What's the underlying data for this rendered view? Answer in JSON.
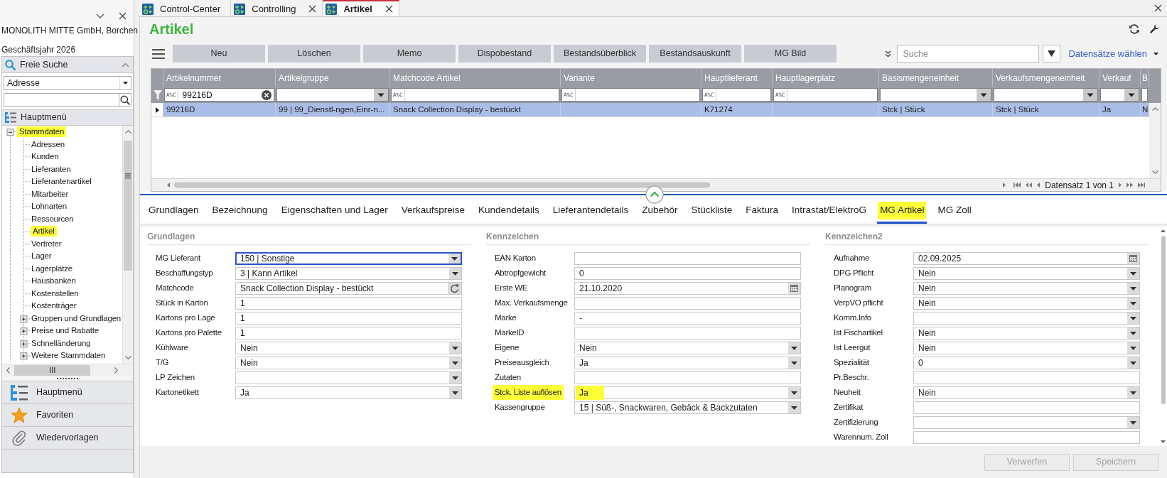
{
  "sidebar": {
    "company": "MONOLITH MITTE GmbH, Borchen",
    "fiscal_year": "Geschäftsjahr 2026",
    "search_panel": {
      "title": "Freie Suche",
      "category": "Adresse"
    },
    "menu_panel": {
      "title": "Hauptmenü",
      "tree": [
        {
          "label": "Stammdaten",
          "highlighted": true,
          "expanded": true,
          "children": [
            {
              "label": "Adressen",
              "highlighted": false
            },
            {
              "label": "Kunden",
              "highlighted": false
            },
            {
              "label": "Lieferanten",
              "highlighted": false
            },
            {
              "label": "Lieferantenartikel",
              "highlighted": false
            },
            {
              "label": "Mitarbeiter",
              "highlighted": false
            },
            {
              "label": "Lohnarten",
              "highlighted": false
            },
            {
              "label": "Ressourcen",
              "highlighted": false
            },
            {
              "label": "Artikel",
              "highlighted": true
            },
            {
              "label": "Vertreter",
              "highlighted": false
            },
            {
              "label": "Lager",
              "highlighted": false
            },
            {
              "label": "Lagerplätze",
              "highlighted": false
            },
            {
              "label": "Hausbanken",
              "highlighted": false
            },
            {
              "label": "Kostenstellen",
              "highlighted": false
            },
            {
              "label": "Kostenträger",
              "highlighted": false
            },
            {
              "label": "Gruppen und Grundlagen",
              "highlighted": false,
              "expanded": false
            },
            {
              "label": "Preise und Rabatte",
              "highlighted": false,
              "expanded": false
            },
            {
              "label": "Schnelländerung",
              "highlighted": false,
              "expanded": false
            },
            {
              "label": "Weitere Stammdaten",
              "highlighted": false,
              "expanded": false
            }
          ]
        }
      ]
    },
    "nav": [
      {
        "label": "Hauptmenü",
        "kind": "menu"
      },
      {
        "label": "Favoriten",
        "kind": "favorites"
      },
      {
        "label": "Wiedervorlagen",
        "kind": "attachments"
      }
    ]
  },
  "tabs": [
    {
      "label": "Control-Center",
      "selected": false,
      "closable": false
    },
    {
      "label": "Controlling",
      "selected": false,
      "closable": true
    },
    {
      "label": "Artikel",
      "selected": true,
      "closable": true
    }
  ],
  "page_title": "Artikel",
  "toolbar": {
    "buttons": [
      "Neu",
      "Löschen",
      "Memo",
      "Dispobestand",
      "Bestandsüberblick",
      "Bestandsauskunft",
      "MG Bild"
    ],
    "search": {
      "placeholder": "Suche"
    },
    "records_link": "Datensätze wählen"
  },
  "grid": {
    "columns": [
      {
        "label": "Artikelnummer",
        "filter": {
          "kind": "text",
          "mode": "A%C",
          "value": "99216D"
        }
      },
      {
        "label": "Artikelgruppe",
        "filter": {
          "kind": "select"
        }
      },
      {
        "label": "Matchcode Artikel",
        "filter": {
          "kind": "text",
          "mode": "A%C"
        }
      },
      {
        "label": "Variante",
        "filter": {
          "kind": "text",
          "mode": "A%C"
        }
      },
      {
        "label": "Hauptlieferant",
        "filter": {
          "kind": "text",
          "mode": "A%C"
        }
      },
      {
        "label": "Hauptlagerplatz",
        "filter": {
          "kind": "text",
          "mode": "A%C"
        }
      },
      {
        "label": "Basismengeneinheit",
        "filter": {
          "kind": "select"
        }
      },
      {
        "label": "Verkaufsmengeneinheit",
        "filter": {
          "kind": "select"
        }
      },
      {
        "label": "Verkauf",
        "filter": {
          "kind": "select"
        }
      },
      {
        "label": "B",
        "filter": {
          "kind": "text"
        }
      }
    ],
    "rows": [
      {
        "selected": true,
        "cells": [
          "99216D",
          "99 | 99_Dienstl-ngen,Einr-n...",
          "Snack Collection Display - bestückt",
          null,
          "K71274",
          null,
          "Stck | Stück",
          "Stck | Stück",
          "Ja",
          "N"
        ]
      }
    ],
    "pager": "Datensatz 1 von 1"
  },
  "detail_tabs": [
    {
      "label": "Grundlagen",
      "selected": false,
      "highlighted": false
    },
    {
      "label": "Bezeichnung",
      "selected": false,
      "highlighted": false
    },
    {
      "label": "Eigenschaften und Lager",
      "selected": false,
      "highlighted": false
    },
    {
      "label": "Verkaufspreise",
      "selected": false,
      "highlighted": false
    },
    {
      "label": "Kundendetails",
      "selected": false,
      "highlighted": false
    },
    {
      "label": "Lieferantendetails",
      "selected": false,
      "highlighted": false
    },
    {
      "label": "Zubehör",
      "selected": false,
      "highlighted": false
    },
    {
      "label": "Stückliste",
      "selected": false,
      "highlighted": false
    },
    {
      "label": "Faktura",
      "selected": false,
      "highlighted": false
    },
    {
      "label": "Intrastat/ElektroG",
      "selected": false,
      "highlighted": false
    },
    {
      "label": "MG Artikel",
      "selected": true,
      "highlighted": true
    },
    {
      "label": "MG Zoll",
      "selected": false,
      "highlighted": false
    }
  ],
  "sections": [
    {
      "title": "Grundlagen",
      "fields": [
        {
          "label": "MG Lieferant",
          "kind": "select",
          "value": "150 | Sonstige",
          "focused": true
        },
        {
          "label": "Beschaffungstyp",
          "kind": "select",
          "value": "3 | Kann Artikel",
          "focused": false
        },
        {
          "label": "Matchcode",
          "kind": "refresh",
          "value": "Snack Collection Display - bestückt",
          "focused": false
        },
        {
          "label": "Stück in Karton",
          "kind": "text",
          "value": "1",
          "focused": false
        },
        {
          "label": "Kartons pro Lage",
          "kind": "text",
          "value": "1",
          "focused": false
        },
        {
          "label": "Kartons pro Palette",
          "kind": "text",
          "value": "1",
          "focused": false
        },
        {
          "label": "Kühlware",
          "kind": "select",
          "value": "Nein",
          "focused": false
        },
        {
          "label": "T/G",
          "kind": "select",
          "value": "Nein",
          "focused": false
        },
        {
          "label": "LP Zeichen",
          "kind": "select",
          "focused": false
        },
        {
          "label": "Kartonetikett",
          "kind": "select",
          "value": "Ja",
          "focused": false
        }
      ]
    },
    {
      "title": "Kennzeichen",
      "fields": [
        {
          "label": "EAN Karton",
          "kind": "text",
          "highlighted": false
        },
        {
          "label": "Abtropfgewicht",
          "kind": "text",
          "value": "0",
          "highlighted": false
        },
        {
          "label": "Erste WE",
          "kind": "date",
          "value": "21.10.2020",
          "highlighted": false
        },
        {
          "label": "Max. Verkaufsmenge",
          "kind": "text",
          "highlighted": false
        },
        {
          "label": "Marke",
          "kind": "text",
          "value": "-",
          "highlighted": false
        },
        {
          "label": "MarkeID",
          "kind": "text",
          "highlighted": false
        },
        {
          "label": "Eigene",
          "kind": "select",
          "value": "Nein",
          "highlighted": false
        },
        {
          "label": "Preiseausgleich",
          "kind": "select",
          "value": "Ja",
          "highlighted": false
        },
        {
          "label": "Zutaten",
          "kind": "text",
          "highlighted": false
        },
        {
          "label": "Stck. Liste auflösen",
          "kind": "select",
          "value": "Ja",
          "highlighted": true
        },
        {
          "label": "Kassengruppe",
          "kind": "select",
          "value": "15 | Süß-, Snackwaren, Gebäck & Backzutaten",
          "highlighted": false
        }
      ]
    },
    {
      "title": "Kennzeichen2",
      "fields": [
        {
          "label": "Aufnahme",
          "kind": "date",
          "value": "02.09.2025"
        },
        {
          "label": "DPG Pflicht",
          "kind": "select",
          "value": "Nein"
        },
        {
          "label": "Planogram",
          "kind": "select",
          "value": "Nein"
        },
        {
          "label": "VerpVO pflicht",
          "kind": "select",
          "value": "Nein"
        },
        {
          "label": "Komm.Info",
          "kind": "select"
        },
        {
          "label": "Ist Fischartikel",
          "kind": "select",
          "value": "Nein"
        },
        {
          "label": "Ist Leergut",
          "kind": "select",
          "value": "Nein"
        },
        {
          "label": "Spezialität",
          "kind": "select",
          "value": "0"
        },
        {
          "label": "Pr.Beschr.",
          "kind": "text"
        },
        {
          "label": "Neuheit",
          "kind": "select",
          "value": "Nein"
        },
        {
          "label": "Zertifikat",
          "kind": "text"
        },
        {
          "label": "Zertifizierung",
          "kind": "select"
        },
        {
          "label": "Warennum. Zoll",
          "kind": "text"
        }
      ]
    }
  ],
  "footer_buttons": [
    {
      "label": "Verwerfen",
      "disabled": true
    },
    {
      "label": "Speichern",
      "disabled": true
    }
  ]
}
